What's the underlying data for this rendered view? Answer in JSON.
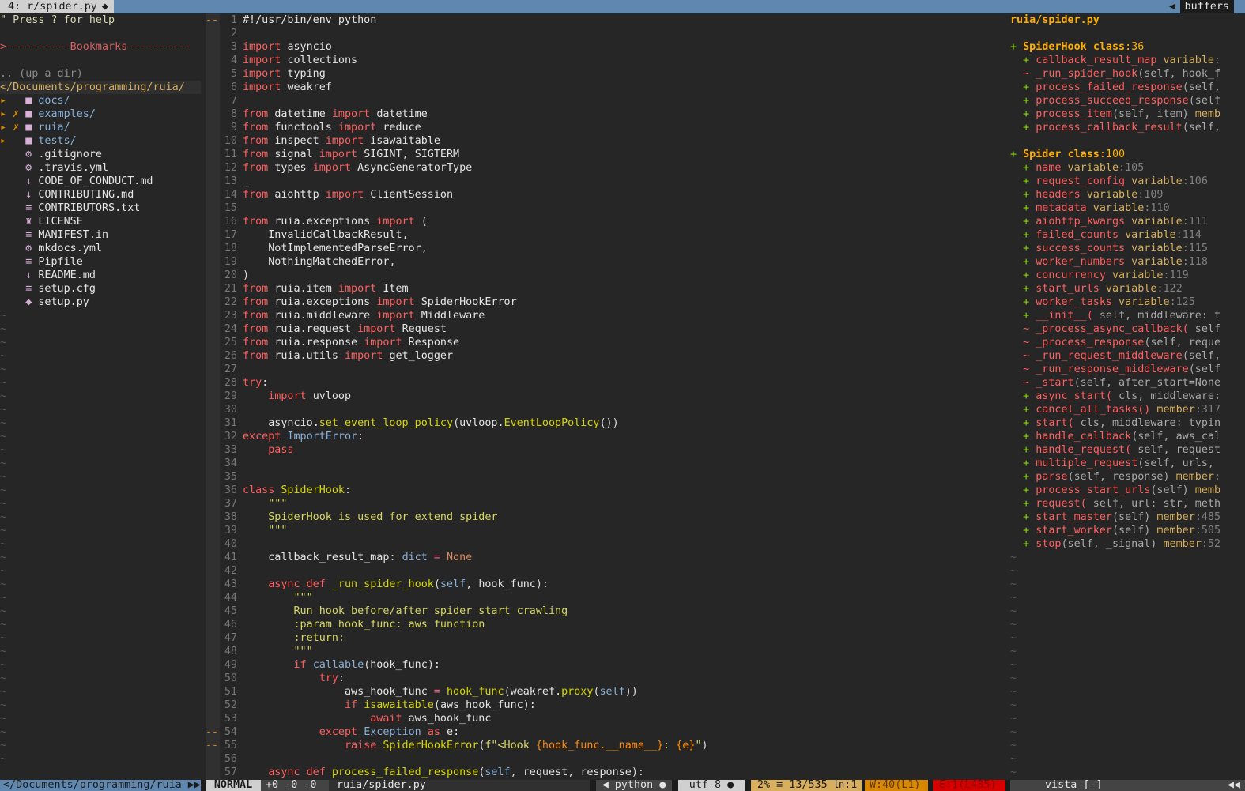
{
  "tabline": {
    "active_tab": "4: r/spider.py",
    "modified_marker": "◆",
    "buffers_label": "buffers"
  },
  "colors": {
    "keyword": "#ff5f5f",
    "builtin": "#87afd7",
    "function": "#d7d700",
    "string": "#d7d75f",
    "number": "#d7875f",
    "operator": "#ff5f87",
    "fstring_brace": "#ff8700"
  },
  "tree": {
    "help": "\" Press ? for help",
    "bookmarks": ">----------Bookmarks----------",
    "updir": ".. (up a dir)",
    "root": "</Documents/programming/ruia/",
    "entries": [
      {
        "arrow": "▸",
        "mark": " ",
        "icon": "folder-icon",
        "glyph": "■",
        "name": "docs/",
        "kind": "dir"
      },
      {
        "arrow": "▸",
        "mark": "✗",
        "icon": "folder-icon",
        "glyph": "■",
        "name": "examples/",
        "kind": "dir"
      },
      {
        "arrow": "▸",
        "mark": "✗",
        "icon": "folder-icon",
        "glyph": "■",
        "name": "ruia/",
        "kind": "dir"
      },
      {
        "arrow": "▸",
        "mark": " ",
        "icon": "folder-icon",
        "glyph": "■",
        "name": "tests/",
        "kind": "dir"
      },
      {
        "arrow": " ",
        "mark": " ",
        "icon": "gear-icon",
        "glyph": "⚙",
        "name": ".gitignore",
        "kind": "file"
      },
      {
        "arrow": " ",
        "mark": " ",
        "icon": "gear-icon",
        "glyph": "⚙",
        "name": ".travis.yml",
        "kind": "file"
      },
      {
        "arrow": " ",
        "mark": " ",
        "icon": "markdown-icon",
        "glyph": "↓",
        "name": "CODE_OF_CONDUCT.md",
        "kind": "file"
      },
      {
        "arrow": " ",
        "mark": " ",
        "icon": "markdown-icon",
        "glyph": "↓",
        "name": "CONTRIBUTING.md",
        "kind": "file"
      },
      {
        "arrow": " ",
        "mark": " ",
        "icon": "text-file-icon",
        "glyph": "≡",
        "name": "CONTRIBUTORS.txt",
        "kind": "file"
      },
      {
        "arrow": " ",
        "mark": " ",
        "icon": "license-icon",
        "glyph": "♜",
        "name": "LICENSE",
        "kind": "file"
      },
      {
        "arrow": " ",
        "mark": " ",
        "icon": "text-file-icon",
        "glyph": "≡",
        "name": "MANIFEST.in",
        "kind": "file"
      },
      {
        "arrow": " ",
        "mark": " ",
        "icon": "gear-icon",
        "glyph": "⚙",
        "name": "mkdocs.yml",
        "kind": "file"
      },
      {
        "arrow": " ",
        "mark": " ",
        "icon": "text-file-icon",
        "glyph": "≡",
        "name": "Pipfile",
        "kind": "file"
      },
      {
        "arrow": " ",
        "mark": " ",
        "icon": "markdown-icon",
        "glyph": "↓",
        "name": "README.md",
        "kind": "file"
      },
      {
        "arrow": " ",
        "mark": " ",
        "icon": "text-file-icon",
        "glyph": "≡",
        "name": "setup.cfg",
        "kind": "file"
      },
      {
        "arrow": " ",
        "mark": " ",
        "icon": "python-icon",
        "glyph": "◆",
        "name": "setup.py",
        "kind": "file"
      }
    ],
    "tilde": "~"
  },
  "editor": {
    "start_line": 1,
    "signs": {
      "1": "--",
      "54": "--",
      "55": "--"
    },
    "lines": [
      "#!/usr/bin/env python",
      "",
      "import asyncio",
      "import collections",
      "import typing",
      "import weakref",
      "",
      "from datetime import datetime",
      "from functools import reduce",
      "from inspect import isawaitable",
      "from signal import SIGINT, SIGTERM",
      "from types import AsyncGeneratorType",
      "_",
      "from aiohttp import ClientSession",
      "",
      "from ruia.exceptions import (",
      "    InvalidCallbackResult,",
      "    NotImplementedParseError,",
      "    NothingMatchedError,",
      ")",
      "from ruia.item import Item",
      "from ruia.exceptions import SpiderHookError",
      "from ruia.middleware import Middleware",
      "from ruia.request import Request",
      "from ruia.response import Response",
      "from ruia.utils import get_logger",
      "",
      "try:",
      "    import uvloop",
      "",
      "    asyncio.set_event_loop_policy(uvloop.EventLoopPolicy())",
      "except ImportError:",
      "    pass",
      "",
      "",
      "class SpiderHook:",
      "    \"\"\"",
      "    SpiderHook is used for extend spider",
      "    \"\"\"",
      "",
      "    callback_result_map: dict = None",
      "",
      "    async def _run_spider_hook(self, hook_func):",
      "        \"\"\"",
      "        Run hook before/after spider start crawling",
      "        :param hook_func: aws function",
      "        :return:",
      "        \"\"\"",
      "        if callable(hook_func):",
      "            try:",
      "                aws_hook_func = hook_func(weakref.proxy(self))",
      "                if isawaitable(aws_hook_func):",
      "                    await aws_hook_func",
      "            except Exception as e:",
      "                raise SpiderHookError(f\"<Hook {hook_func.__name__}: {e}\")",
      "",
      "    async def process_failed_response(self, request, response):"
    ]
  },
  "vista": {
    "title": "ruia/spider.py",
    "groups": [
      {
        "sign": "+",
        "name": "SpiderHook",
        "kind": "class",
        "line": ":36",
        "items": [
          {
            "sign": "+",
            "name": "callback_result_map",
            "sig": "",
            "kind": " variable",
            "line": ":"
          },
          {
            "sign": "~",
            "name": "_run_spider_hook",
            "sig": "(self, hook_f",
            "kind": "",
            "line": ""
          },
          {
            "sign": "+",
            "name": "process_failed_response",
            "sig": "(self,",
            "kind": "",
            "line": ""
          },
          {
            "sign": "+",
            "name": "process_succeed_response",
            "sig": "(self",
            "kind": "",
            "line": ""
          },
          {
            "sign": "+",
            "name": "process_item",
            "sig": "(self, item)",
            "kind": " memb",
            "line": ""
          },
          {
            "sign": "+",
            "name": "process_callback_result",
            "sig": "(self,",
            "kind": "",
            "line": ""
          }
        ]
      },
      {
        "sign": "+",
        "name": "Spider",
        "kind": "class",
        "line": ":100",
        "items": [
          {
            "sign": "+",
            "name": "name",
            "sig": "",
            "kind": " variable",
            "line": ":105"
          },
          {
            "sign": "+",
            "name": "request_config",
            "sig": "",
            "kind": " variable",
            "line": ":106"
          },
          {
            "sign": "+",
            "name": "headers",
            "sig": "",
            "kind": " variable",
            "line": ":109"
          },
          {
            "sign": "+",
            "name": "metadata",
            "sig": "",
            "kind": " variable",
            "line": ":110"
          },
          {
            "sign": "+",
            "name": "aiohttp_kwargs",
            "sig": "",
            "kind": " variable",
            "line": ":111"
          },
          {
            "sign": "+",
            "name": "failed_counts",
            "sig": "",
            "kind": " variable",
            "line": ":114"
          },
          {
            "sign": "+",
            "name": "success_counts",
            "sig": "",
            "kind": " variable",
            "line": ":115"
          },
          {
            "sign": "+",
            "name": "worker_numbers",
            "sig": "",
            "kind": " variable",
            "line": ":118"
          },
          {
            "sign": "+",
            "name": "concurrency",
            "sig": "",
            "kind": " variable",
            "line": ":119"
          },
          {
            "sign": "+",
            "name": "start_urls",
            "sig": "",
            "kind": " variable",
            "line": ":122"
          },
          {
            "sign": "+",
            "name": "worker_tasks",
            "sig": "",
            "kind": " variable",
            "line": ":125"
          },
          {
            "sign": "+",
            "name": "__init__(",
            "sig": " self, middleware: t",
            "kind": "",
            "line": ""
          },
          {
            "sign": "~",
            "name": "_process_async_callback(",
            "sig": " self",
            "kind": "",
            "line": ""
          },
          {
            "sign": "~",
            "name": "_process_response",
            "sig": "(self, reque",
            "kind": "",
            "line": ""
          },
          {
            "sign": "~",
            "name": "_run_request_middleware",
            "sig": "(self,",
            "kind": "",
            "line": ""
          },
          {
            "sign": "~",
            "name": "_run_response_middleware",
            "sig": "(self",
            "kind": "",
            "line": ""
          },
          {
            "sign": "~",
            "name": "_start",
            "sig": "(self, after_start=None",
            "kind": "",
            "line": ""
          },
          {
            "sign": "+",
            "name": "async_start(",
            "sig": " cls, middleware:",
            "kind": "",
            "line": ""
          },
          {
            "sign": "+",
            "name": "cancel_all_tasks()",
            "sig": "",
            "kind": " member",
            "line": ":317"
          },
          {
            "sign": "+",
            "name": "start(",
            "sig": " cls, middleware: typin",
            "kind": "",
            "line": ""
          },
          {
            "sign": "+",
            "name": "handle_callback",
            "sig": "(self, aws_cal",
            "kind": "",
            "line": ""
          },
          {
            "sign": "+",
            "name": "handle_request(",
            "sig": " self, request",
            "kind": "",
            "line": ""
          },
          {
            "sign": "+",
            "name": "multiple_request",
            "sig": "(self, urls,",
            "kind": "",
            "line": ""
          },
          {
            "sign": "+",
            "name": "parse",
            "sig": "(self, response)",
            "kind": " member",
            "line": ":"
          },
          {
            "sign": "+",
            "name": "process_start_urls",
            "sig": "(self)",
            "kind": " memb",
            "line": ""
          },
          {
            "sign": "+",
            "name": "request(",
            "sig": " self, url: str, meth",
            "kind": "",
            "line": ""
          },
          {
            "sign": "+",
            "name": "start_master",
            "sig": "(self)",
            "kind": " member",
            "line": ":485"
          },
          {
            "sign": "+",
            "name": "start_worker",
            "sig": "(self)",
            "kind": " member",
            "line": ":505"
          },
          {
            "sign": "+",
            "name": "stop",
            "sig": "(self, _signal)",
            "kind": " member",
            "line": ":52"
          }
        ]
      }
    ]
  },
  "status": {
    "tree_path": "</Documents/programming/ruia",
    "tree_arrows": "▶▶",
    "mode": "NORMAL",
    "hunks": "+0 -0 -0",
    "file": "ruia/spider.py",
    "filetype": "◀ python ●",
    "encoding": "utf-8 ●",
    "position": "2% ≡ 13/535 ㏑:1",
    "warnings": "W:40(L1)",
    "errors": "E:1(L435)",
    "vista_label": "vista  [-]",
    "vista_arrows": "◀◀"
  }
}
